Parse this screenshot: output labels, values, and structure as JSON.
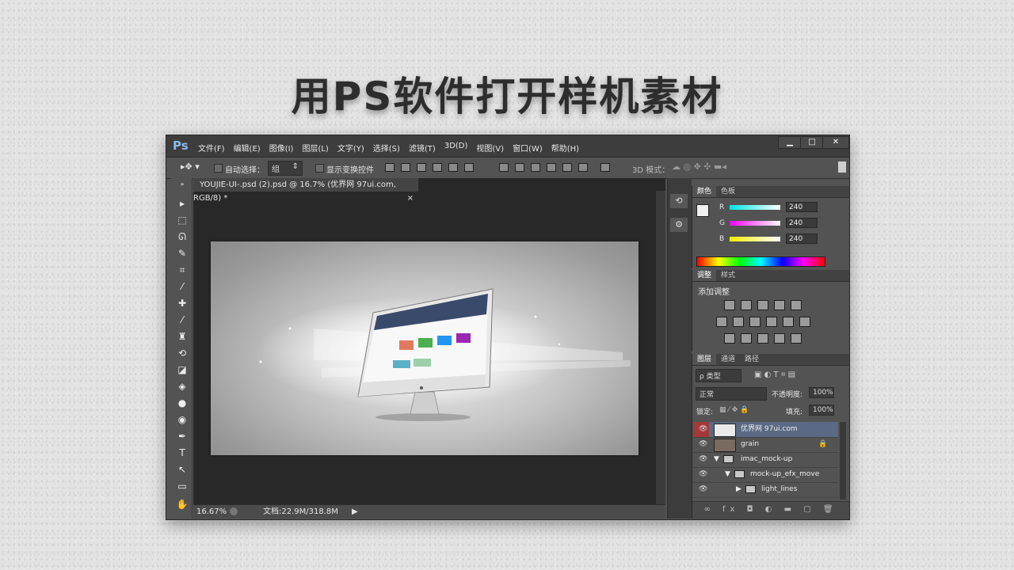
{
  "headline": "用PS软件打开样机素材",
  "app": {
    "logo": "Ps",
    "menu": [
      "文件(F)",
      "编辑(E)",
      "图像(I)",
      "图层(L)",
      "文字(Y)",
      "选择(S)",
      "滤镜(T)",
      "3D(D)",
      "视图(V)",
      "窗口(W)",
      "帮助(H)"
    ],
    "window_buttons": {
      "minimize": "▁",
      "maximize": "□",
      "close": "✕"
    }
  },
  "options": {
    "auto_select_label": "自动选择：",
    "auto_select_value": "组",
    "show_transform_label": "显示变换控件",
    "mode_3d_label": "3D 模式："
  },
  "document": {
    "tab_title": "YOUJIE-UI-.psd (2).psd @ 16.7% (优界网 97ui.com, RGB/8) *",
    "tab_close": "×",
    "zoom": "16.67%",
    "doc_size": "文档:22.9M/318.8M"
  },
  "color_panel": {
    "tabs": [
      "颜色",
      "色板"
    ],
    "channels": [
      {
        "label": "R",
        "value": "240",
        "gradient": "linear-gradient(to right,#00e5e5,#ffffff)"
      },
      {
        "label": "G",
        "value": "240",
        "gradient": "linear-gradient(to right,#ff00ff,#ffffff)"
      },
      {
        "label": "B",
        "value": "240",
        "gradient": "linear-gradient(to right,#f0f000,#ffffff)"
      }
    ],
    "foreground": "#f0f0f0"
  },
  "adjust_panel": {
    "tabs": [
      "调整",
      "样式"
    ],
    "add_label": "添加调整"
  },
  "layers_panel": {
    "tabs": [
      "图层",
      "通道",
      "路径"
    ],
    "filter_label": "ρ 类型",
    "blend_mode": "正常",
    "opacity_label": "不透明度:",
    "opacity_value": "100%",
    "lock_label": "锁定:",
    "fill_label": "填充:",
    "fill_value": "100%",
    "layers": [
      {
        "name": "优界网 97ui.com",
        "selected": true
      },
      {
        "name": "grain",
        "locked": true
      },
      {
        "name": "imac_mock-up",
        "folder": true
      },
      {
        "name": "mock-up_efx_move",
        "folder": true
      },
      {
        "name": "light_lines",
        "folder": true
      }
    ]
  }
}
